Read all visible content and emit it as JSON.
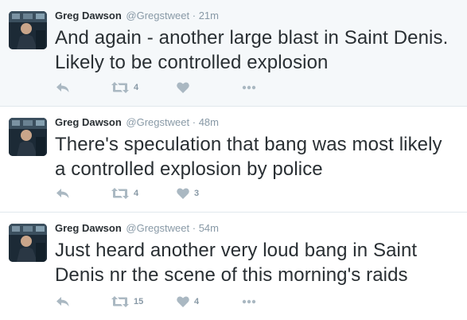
{
  "tweets": [
    {
      "fullname": "Greg Dawson",
      "handle": "@Gregstweet",
      "separator": "·",
      "time": "21m",
      "text": "And again - another large blast in Saint Denis. Likely to be controlled explosion",
      "retweets": "4",
      "likes": "",
      "highlighted": true
    },
    {
      "fullname": "Greg Dawson",
      "handle": "@Gregstweet",
      "separator": "·",
      "time": "48m",
      "text": "There's speculation that bang was most likely a controlled explosion by police",
      "retweets": "4",
      "likes": "3",
      "highlighted": false
    },
    {
      "fullname": "Greg Dawson",
      "handle": "@Gregstweet",
      "separator": "·",
      "time": "54m",
      "text": "Just heard another very loud bang in Saint Denis nr the scene of this morning's raids",
      "retweets": "15",
      "likes": "4",
      "highlighted": false
    }
  ],
  "icons": {
    "reply": "reply-icon",
    "retweet": "retweet-icon",
    "like": "heart-icon",
    "more": "more-icon"
  },
  "colors": {
    "icon": "#aab8c2",
    "meta": "#8899a6",
    "text": "#292f33",
    "highlight_bg": "#f5f8fa"
  }
}
